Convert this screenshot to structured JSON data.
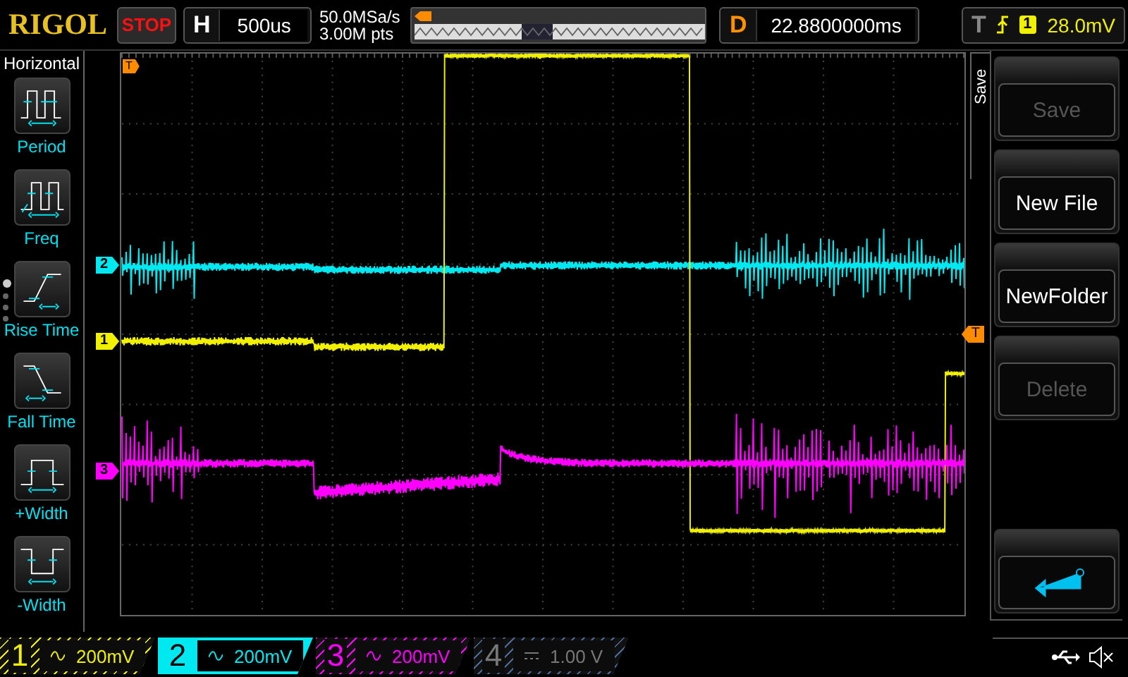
{
  "header": {
    "brand": "RIGOL",
    "run_state": "STOP",
    "timebase": {
      "label": "H",
      "value": "500us"
    },
    "sample_rate": "50.0MSa/s",
    "memory_depth": "3.00M pts",
    "delay": {
      "label": "D",
      "value": "22.8800000ms"
    },
    "trigger": {
      "label": "T",
      "kind": "rising",
      "source": "1",
      "level": "28.0mV"
    }
  },
  "measure_panel": {
    "title": "Horizontal",
    "items": [
      {
        "label": "Period",
        "kind": "period"
      },
      {
        "label": "Freq",
        "kind": "freq"
      },
      {
        "label": "Rise Time",
        "kind": "rise"
      },
      {
        "label": "Fall Time",
        "kind": "fall"
      },
      {
        "label": "+Width",
        "kind": "pwidth"
      },
      {
        "label": "-Width",
        "kind": "nwidth"
      }
    ],
    "pages": [
      {
        "selected": true
      },
      {
        "selected": false
      },
      {
        "selected": false
      },
      {
        "selected": false
      }
    ]
  },
  "plot": {
    "trigger_position_marker": "T",
    "trigger_level_marker": "T",
    "channel_markers": [
      {
        "label": "2",
        "color": "#00e8f0"
      },
      {
        "label": "1",
        "color": "#f0f000"
      },
      {
        "label": "3",
        "color": "#ff00ff"
      }
    ],
    "traces": [
      {
        "kind": "cyan_wave",
        "color": "#00e8f0"
      },
      {
        "kind": "yellow_wave",
        "color": "#f0f000"
      },
      {
        "kind": "magenta_wave",
        "color": "#ff00ff"
      }
    ]
  },
  "save_menu": {
    "title": "Save",
    "buttons": [
      {
        "label": "Save",
        "disabled": true
      },
      {
        "label": "New File",
        "disabled": false
      },
      {
        "label": "NewFolder",
        "disabled": false
      },
      {
        "label": "Delete",
        "disabled": true
      }
    ],
    "back_button": {
      "kind": "return"
    }
  },
  "channels": [
    {
      "number": "1",
      "kind": "ac",
      "scale": "200mV",
      "selected": false,
      "enabled": true,
      "color": "#f0f000"
    },
    {
      "number": "2",
      "kind": "ac",
      "scale": "200mV",
      "selected": true,
      "enabled": true,
      "color": "#00e8f0"
    },
    {
      "number": "3",
      "kind": "ac",
      "scale": "200mV",
      "selected": false,
      "enabled": true,
      "color": "#ff00ff"
    },
    {
      "number": "4",
      "kind": "dc",
      "scale": "1.00 V",
      "selected": false,
      "enabled": false,
      "color": "#4a6a9a"
    }
  ]
}
